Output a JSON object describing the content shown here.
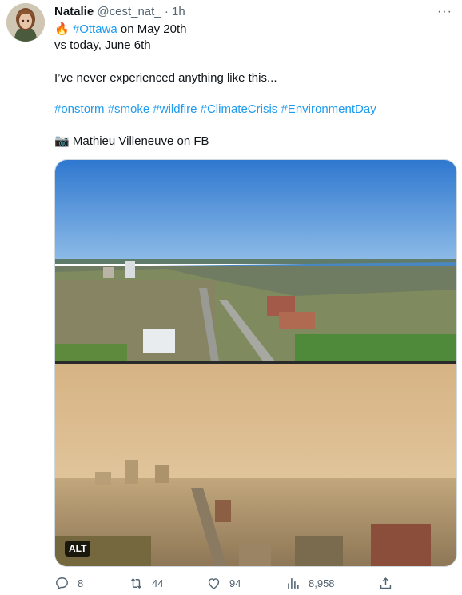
{
  "tweet": {
    "author_name": "Natalie",
    "handle": "@cest_nat_",
    "separator": "·",
    "time": "1h",
    "more_label": "···",
    "line1_suffix": " on May 20th",
    "hashtag_city": "#Ottawa",
    "line2": "vs today, June 6th",
    "line3": "I’ve never experienced anything like this...",
    "hashtags": [
      "#onstorm",
      "#smoke",
      "#wildfire",
      "#ClimateCrisis",
      "#EnvironmentDay"
    ],
    "photo_credit": "Mathieu Villeneuve on FB",
    "fire_emoji": "🔥",
    "camera_emoji": "📷"
  },
  "media": {
    "alt_label": "ALT",
    "clear_sky_color": "#3f86d6",
    "smoke_sky_color": "#d9b889"
  },
  "actions": {
    "replies": "8",
    "retweets": "44",
    "likes": "94",
    "views": "8,958"
  },
  "icons": [
    "reply-icon",
    "retweet-icon",
    "like-icon",
    "views-icon",
    "share-icon"
  ]
}
